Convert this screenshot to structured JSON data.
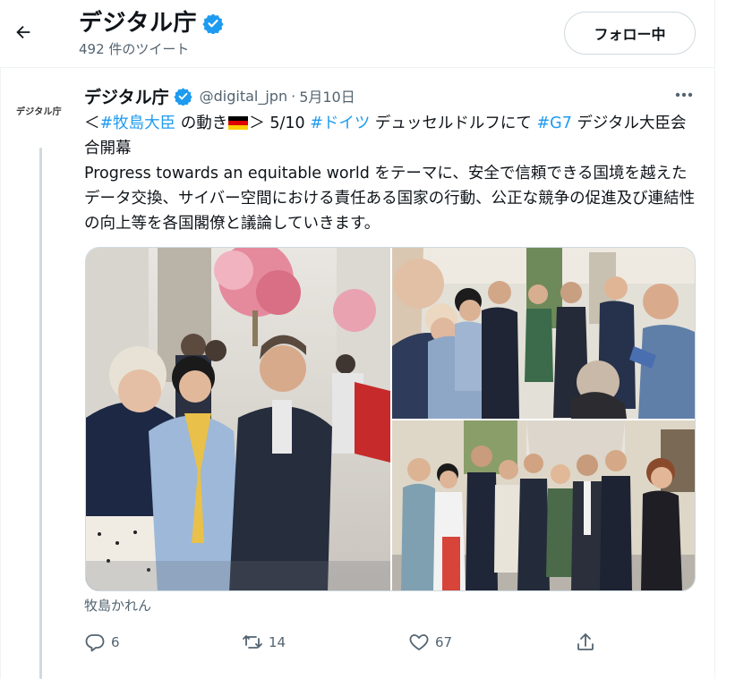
{
  "header": {
    "title": "デジタル庁",
    "tweet_count": "492 件のツイート",
    "follow_label": "フォロー中"
  },
  "avatar": {
    "logo_text": "デジタル庁"
  },
  "tweet": {
    "author_name": "デジタル庁",
    "handle": "@digital_jpn",
    "separator": "·",
    "date": "5月10日",
    "text": {
      "open_bracket": "＜",
      "hashtag_minister": "#牧島大臣",
      "after_minister": " の動き",
      "after_flag": "＞ 5/10 ",
      "hashtag_germany": "#ドイツ",
      "after_germany": " デュッセルドルフにて ",
      "hashtag_g7": "#G7",
      "after_g7": " デジタル大臣会合開幕",
      "body": "Progress towards an equitable world  をテーマに、安全で信頼できる国境を越えたデータ交換、サイバー空間における責任ある国家の行動、公正な競争の促進及び連結性の向上等を各国閣僚と議論していきます。"
    },
    "tagged_user": "牧島かれん",
    "stats": {
      "replies": "6",
      "retweets": "14",
      "likes": "67"
    }
  },
  "colors": {
    "accent": "#1d9bf0",
    "verified": "#1d9bf0",
    "muted": "#536471",
    "border": "#cfd9de"
  },
  "icons": [
    "back-arrow-icon",
    "verified-badge-icon",
    "more-icon",
    "reply-icon",
    "retweet-icon",
    "like-icon",
    "share-icon",
    "germany-flag-icon"
  ]
}
